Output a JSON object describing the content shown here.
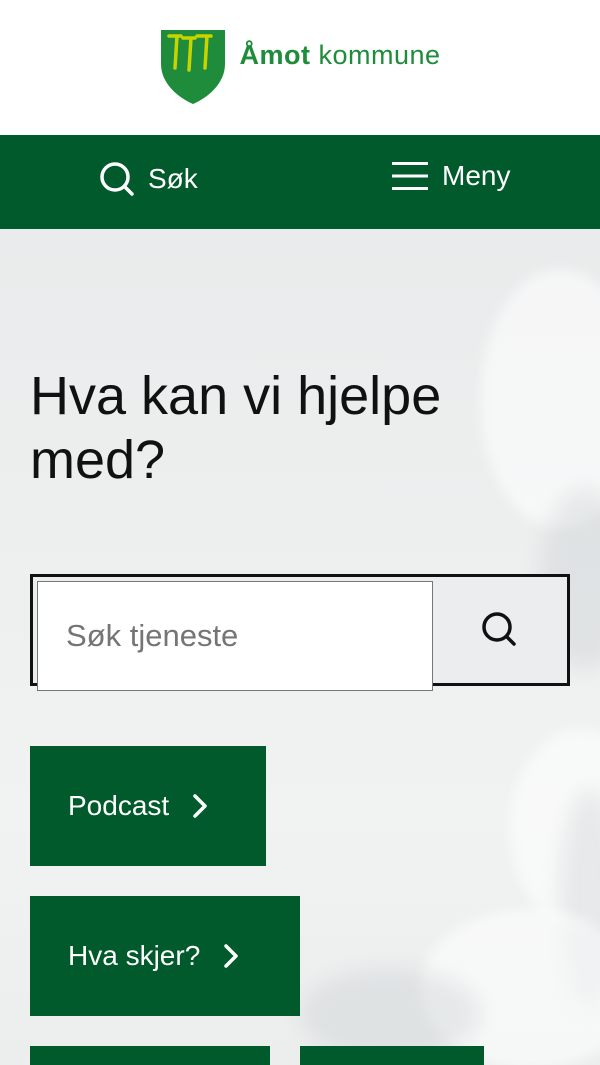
{
  "header": {
    "logo_name_bold": "Åmot",
    "logo_name_rest": " kommune"
  },
  "nav": {
    "search_label": "Søk",
    "menu_label": "Meny"
  },
  "hero": {
    "heading": "Hva kan vi hjelpe med?",
    "search": {
      "placeholder": "Søk tjeneste"
    },
    "quick_links": [
      {
        "label": "Podcast"
      },
      {
        "label": "Hva skjer?"
      },
      {
        "label": ""
      },
      {
        "label": ""
      }
    ]
  },
  "colors": {
    "brand_green": "#005a2b",
    "logo_green": "#1e8c3a",
    "shield_yellow": "#c8d400"
  },
  "icons": [
    "coat-of-arms-icon",
    "search-icon",
    "hamburger-menu-icon",
    "chevron-right-icon"
  ]
}
